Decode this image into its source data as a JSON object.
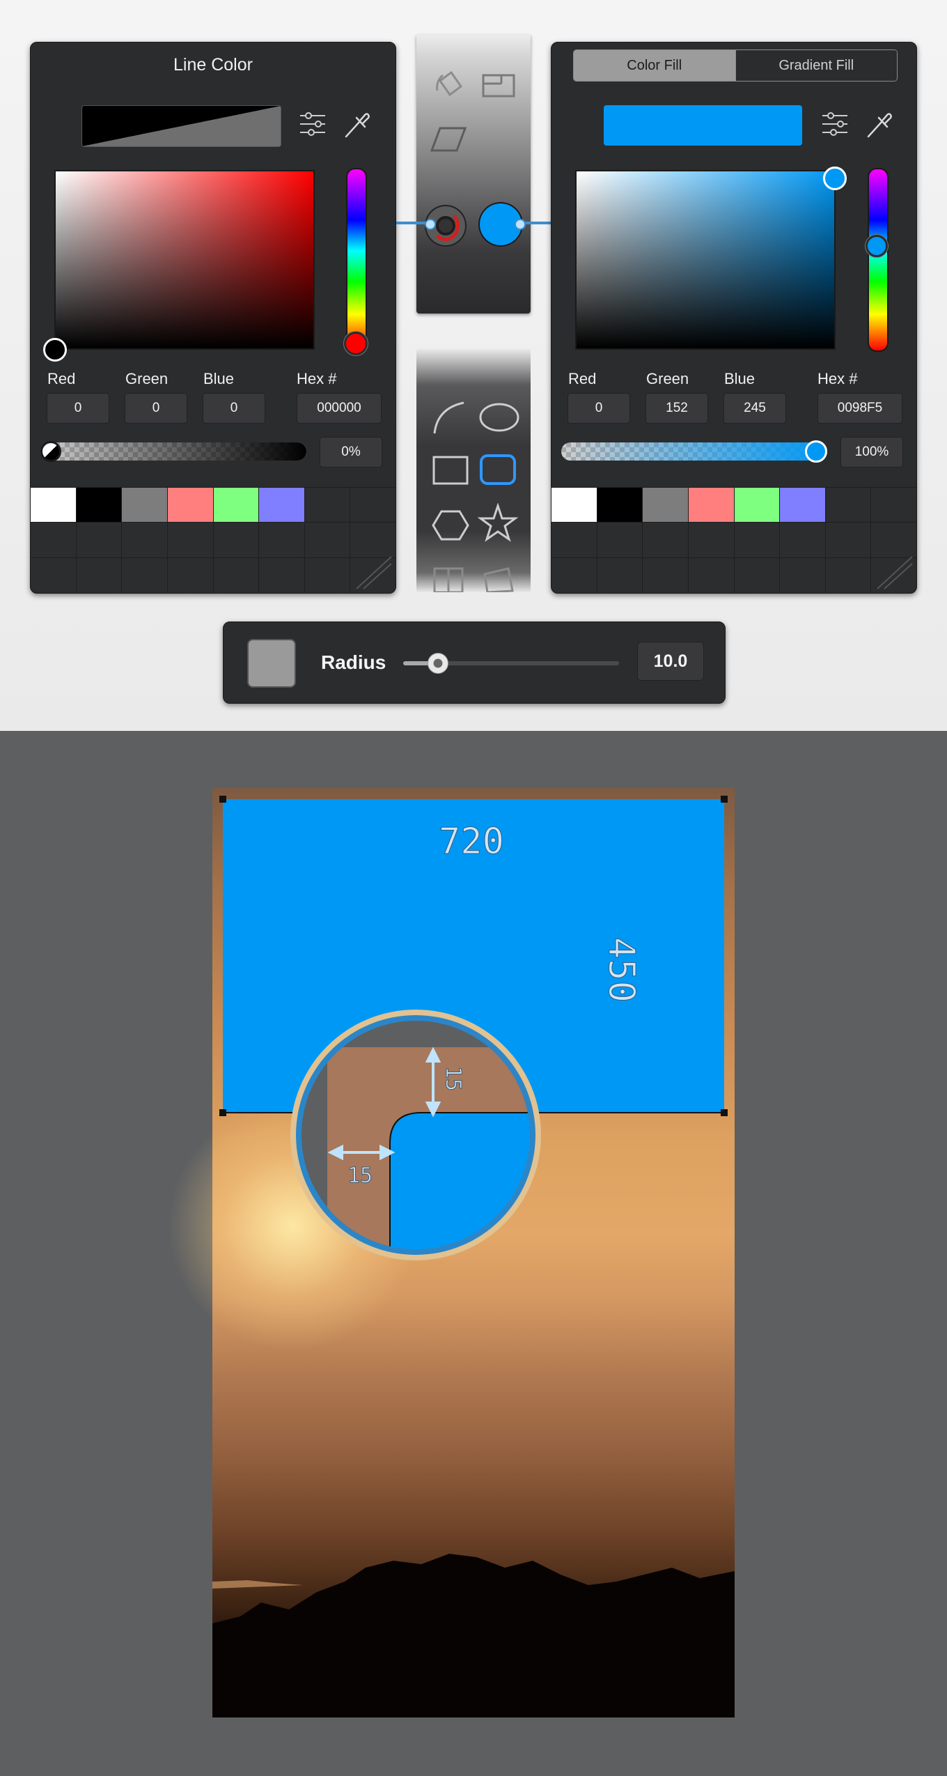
{
  "line_panel": {
    "title": "Line Color",
    "labels": {
      "red": "Red",
      "green": "Green",
      "blue": "Blue",
      "hex": "Hex #"
    },
    "values": {
      "red": "0",
      "green": "0",
      "blue": "0",
      "hex": "000000"
    },
    "alpha": "0%",
    "alpha_level": 0.0,
    "swatches": [
      "#ffffff",
      "#000000",
      "#7d7d7d",
      "#ff7f7f",
      "#7fff7f",
      "#7f7fff"
    ]
  },
  "fill_panel": {
    "tabs": {
      "color_fill": "Color Fill",
      "gradient_fill": "Gradient Fill"
    },
    "labels": {
      "red": "Red",
      "green": "Green",
      "blue": "Blue",
      "hex": "Hex #"
    },
    "values": {
      "red": "0",
      "green": "152",
      "blue": "245",
      "hex": "0098F5"
    },
    "alpha": "100%",
    "alpha_level": 1.0,
    "fill_color": "#0098f5",
    "swatches": [
      "#ffffff",
      "#000000",
      "#7d7d7d",
      "#ff7f7f",
      "#7fff7f",
      "#7f7fff"
    ]
  },
  "radius_control": {
    "label": "Radius",
    "value": "10.0",
    "level": 0.16
  },
  "canvas": {
    "width_label": "720",
    "height_label": "450",
    "radius_label_vertical": "15",
    "radius_label_horizontal": "15",
    "shape_color": "#0098f5"
  },
  "icons": {
    "tools": [
      "rotate-icon",
      "resize-icon",
      "skew-icon",
      "line-color-icon",
      "fill-color-icon",
      "curve-icon",
      "ellipse-icon",
      "rectangle-icon",
      "rounded-rectangle-icon",
      "hexagon-icon",
      "star-icon"
    ],
    "panel": [
      "sliders-icon",
      "eyedropper-icon"
    ]
  }
}
